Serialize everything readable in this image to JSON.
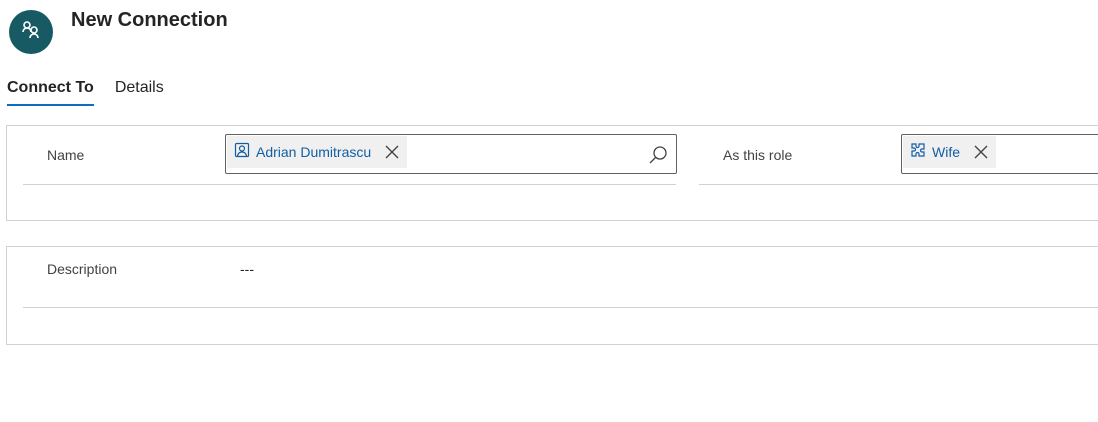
{
  "header": {
    "title": "New Connection",
    "avatar_icon": "connection-icon",
    "avatar_color": "#175a63"
  },
  "tabs": [
    {
      "label": "Connect To",
      "active": true
    },
    {
      "label": "Details",
      "active": false
    }
  ],
  "connect_to": {
    "name_label": "Name",
    "name_value": "Adrian Dumitrascu",
    "name_icon": "contact-icon",
    "role_label": "As this role",
    "role_value": "Wife",
    "role_icon": "role-icon"
  },
  "description": {
    "label": "Description",
    "value": "---"
  },
  "colors": {
    "accent": "#0f6cbd",
    "link": "#115ea3"
  }
}
